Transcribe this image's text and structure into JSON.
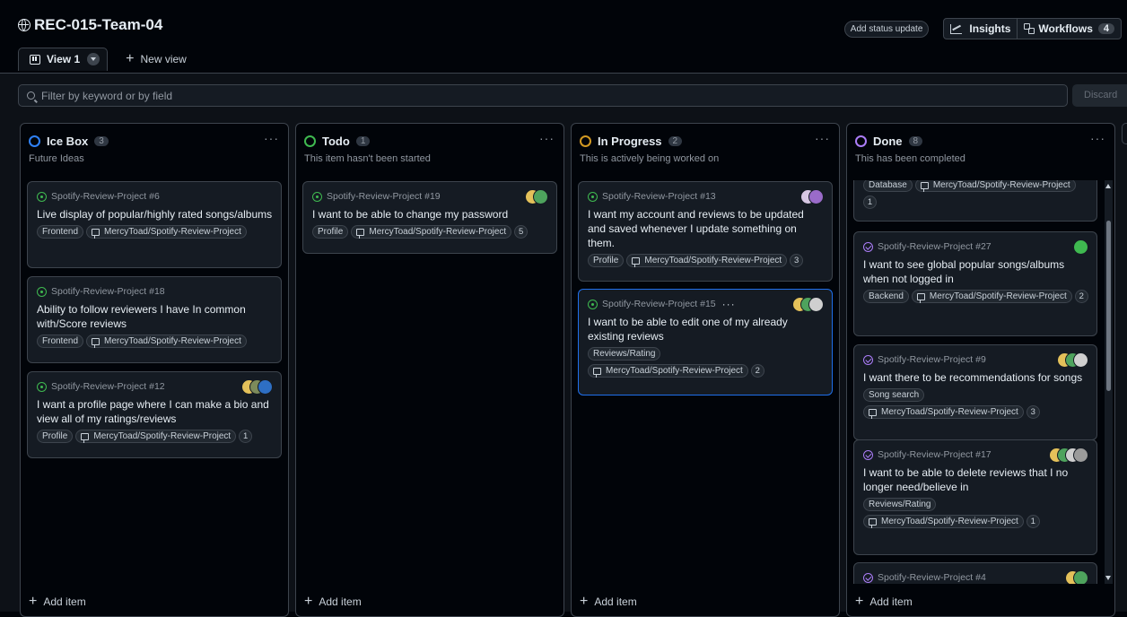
{
  "project": {
    "title": "REC-015-Team-04"
  },
  "header": {
    "status_update": "Add status update",
    "insights": "Insights",
    "workflows": "Workflows",
    "workflows_count": "4"
  },
  "tabs": {
    "active": "View 1",
    "new_view": "New view"
  },
  "filter": {
    "placeholder": "Filter by keyword or by field",
    "discard": "Discard"
  },
  "add_item_label": "Add item",
  "colors": {
    "green": "#3fb950",
    "orange": "#d29922",
    "purple": "#ab7df8",
    "blue": "#2f81f7",
    "accent": "#1f6feb"
  },
  "columns": [
    {
      "name": "Ice Box",
      "count": "3",
      "description": "Future Ideas",
      "status_color": "#2f81f7",
      "cards": [
        {
          "ref": "Spotify-Review-Project #6",
          "title": "Live display of popular/highly rated songs/albums",
          "labels": [
            "Frontend"
          ],
          "repo": "MercyToad/Spotify-Review-Project",
          "comments": ""
        },
        {
          "ref": "Spotify-Review-Project #18",
          "title": "Ability to follow reviewers I have In common with/Score reviews",
          "labels": [
            "Frontend"
          ],
          "repo": "MercyToad/Spotify-Review-Project",
          "comments": ""
        },
        {
          "ref": "Spotify-Review-Project #12",
          "title": "I want a profile page where I can make a bio and view all of my ratings/reviews",
          "labels": [
            "Profile"
          ],
          "repo": "MercyToad/Spotify-Review-Project",
          "comments": "1"
        }
      ]
    },
    {
      "name": "Todo",
      "count": "1",
      "description": "This item hasn't been started",
      "status_color": "#3fb950",
      "cards": [
        {
          "ref": "Spotify-Review-Project #19",
          "title": "I want to be able to change my password",
          "labels": [
            "Profile"
          ],
          "repo": "MercyToad/Spotify-Review-Project",
          "comments": "5"
        }
      ]
    },
    {
      "name": "In Progress",
      "count": "2",
      "description": "This is actively being worked on",
      "status_color": "#d29922",
      "cards": [
        {
          "ref": "Spotify-Review-Project #13",
          "title": "I want my account and reviews to be updated and saved whenever I update something on them.",
          "labels": [
            "Profile"
          ],
          "repo": "MercyToad/Spotify-Review-Project",
          "comments": "3"
        },
        {
          "ref": "Spotify-Review-Project #15",
          "title": "I want to be able to edit one of my already existing reviews",
          "labels": [
            "Reviews/Rating"
          ],
          "repo": "MercyToad/Spotify-Review-Project",
          "comments": "2"
        }
      ]
    },
    {
      "name": "Done",
      "count": "8",
      "description": "This has been completed",
      "status_color": "#ab7df8",
      "cards": [
        {
          "ref": "",
          "title": "",
          "labels": [
            "Database"
          ],
          "repo": "MercyToad/Spotify-Review-Project",
          "comments": "1"
        },
        {
          "ref": "Spotify-Review-Project #27",
          "title": "I want to see global popular songs/albums when not logged in",
          "labels": [
            "Backend"
          ],
          "repo": "MercyToad/Spotify-Review-Project",
          "comments": "2"
        },
        {
          "ref": "Spotify-Review-Project #9",
          "title": "I want there to be recommendations for songs",
          "labels": [
            "Song search"
          ],
          "repo": "MercyToad/Spotify-Review-Project",
          "comments": "3"
        },
        {
          "ref": "Spotify-Review-Project #17",
          "title": "I want to be able to delete reviews that I no longer need/believe in",
          "labels": [
            "Reviews/Rating"
          ],
          "repo": "MercyToad/Spotify-Review-Project",
          "comments": "1"
        },
        {
          "ref": "Spotify-Review-Project #4",
          "title": "",
          "labels": [],
          "repo": "",
          "comments": ""
        }
      ]
    }
  ]
}
